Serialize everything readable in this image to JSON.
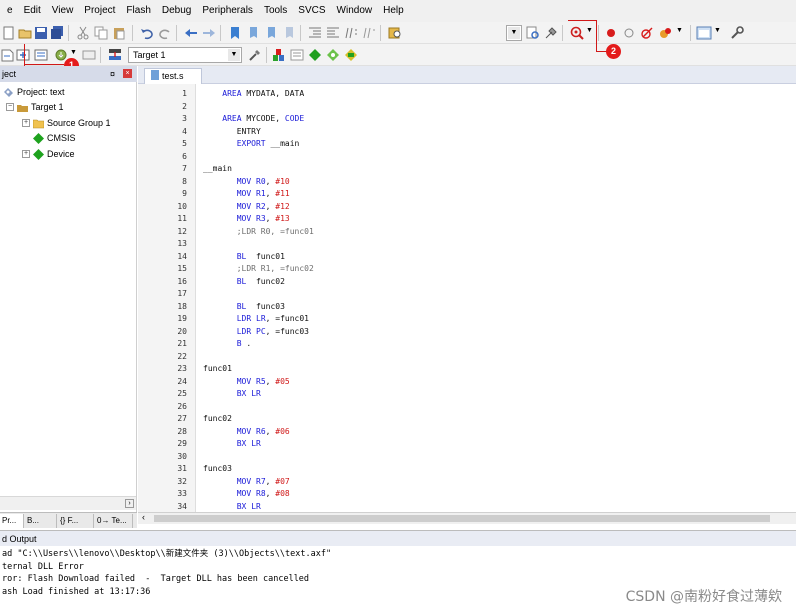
{
  "menu": [
    "e",
    "Edit",
    "View",
    "Project",
    "Flash",
    "Debug",
    "Peripherals",
    "Tools",
    "SVCS",
    "Window",
    "Help"
  ],
  "toolbar2": {
    "target_select": "Target 1"
  },
  "annotations": {
    "badge1": "1",
    "badge2": "2"
  },
  "project_pane": {
    "header": "ject",
    "root": "Project: text",
    "target": "Target 1",
    "items": [
      "Source Group 1",
      "CMSIS",
      "Device"
    ],
    "tabs": [
      "Pr...",
      "B...",
      "{} F...",
      "0→ Te..."
    ]
  },
  "editor": {
    "tab": "test.s",
    "lines": [
      {
        "n": "1",
        "t": [
          {
            "c": "    "
          },
          {
            "c": "AREA",
            "k": "kw"
          },
          {
            "c": " MYDATA, DATA"
          }
        ]
      },
      {
        "n": "2",
        "t": []
      },
      {
        "n": "3",
        "t": [
          {
            "c": "    "
          },
          {
            "c": "AREA",
            "k": "kw"
          },
          {
            "c": " MYCODE, "
          },
          {
            "c": "CODE",
            "k": "kw"
          }
        ]
      },
      {
        "n": "4",
        "t": [
          {
            "c": "       ENTRY"
          }
        ]
      },
      {
        "n": "5",
        "t": [
          {
            "c": "       "
          },
          {
            "c": "EXPORT",
            "k": "kw"
          },
          {
            "c": " __main"
          }
        ]
      },
      {
        "n": "6",
        "t": []
      },
      {
        "n": "7",
        "t": [
          {
            "c": "__main"
          }
        ]
      },
      {
        "n": "8",
        "t": [
          {
            "c": "       "
          },
          {
            "c": "MOV",
            "k": "kw"
          },
          {
            "c": " "
          },
          {
            "c": "R0",
            "k": "kw"
          },
          {
            "c": ", "
          },
          {
            "c": "#10",
            "k": "num"
          }
        ]
      },
      {
        "n": "9",
        "t": [
          {
            "c": "       "
          },
          {
            "c": "MOV",
            "k": "kw"
          },
          {
            "c": " "
          },
          {
            "c": "R1",
            "k": "kw"
          },
          {
            "c": ", "
          },
          {
            "c": "#11",
            "k": "num"
          }
        ]
      },
      {
        "n": "10",
        "t": [
          {
            "c": "       "
          },
          {
            "c": "MOV",
            "k": "kw"
          },
          {
            "c": " "
          },
          {
            "c": "R2",
            "k": "kw"
          },
          {
            "c": ", "
          },
          {
            "c": "#12",
            "k": "num"
          }
        ]
      },
      {
        "n": "11",
        "t": [
          {
            "c": "       "
          },
          {
            "c": "MOV",
            "k": "kw"
          },
          {
            "c": " "
          },
          {
            "c": "R3",
            "k": "kw"
          },
          {
            "c": ", "
          },
          {
            "c": "#13",
            "k": "num"
          }
        ]
      },
      {
        "n": "12",
        "t": [
          {
            "c": "       ;LDR R0, =func01",
            "k": "cm"
          }
        ]
      },
      {
        "n": "13",
        "t": []
      },
      {
        "n": "14",
        "t": [
          {
            "c": "       "
          },
          {
            "c": "BL",
            "k": "kw"
          },
          {
            "c": "  func01"
          }
        ]
      },
      {
        "n": "15",
        "t": [
          {
            "c": "       ;LDR R1, =func02",
            "k": "cm"
          }
        ]
      },
      {
        "n": "16",
        "t": [
          {
            "c": "       "
          },
          {
            "c": "BL",
            "k": "kw"
          },
          {
            "c": "  func02"
          }
        ]
      },
      {
        "n": "17",
        "t": []
      },
      {
        "n": "18",
        "t": [
          {
            "c": "       "
          },
          {
            "c": "BL",
            "k": "kw"
          },
          {
            "c": "  func03"
          }
        ]
      },
      {
        "n": "19",
        "t": [
          {
            "c": "       "
          },
          {
            "c": "LDR",
            "k": "kw"
          },
          {
            "c": " "
          },
          {
            "c": "LR",
            "k": "kw"
          },
          {
            "c": ", =func01"
          }
        ]
      },
      {
        "n": "20",
        "t": [
          {
            "c": "       "
          },
          {
            "c": "LDR",
            "k": "kw"
          },
          {
            "c": " "
          },
          {
            "c": "PC",
            "k": "kw"
          },
          {
            "c": ", =func03"
          }
        ]
      },
      {
        "n": "21",
        "t": [
          {
            "c": "       "
          },
          {
            "c": "B",
            "k": "kw"
          },
          {
            "c": " ."
          }
        ]
      },
      {
        "n": "22",
        "t": []
      },
      {
        "n": "23",
        "t": [
          {
            "c": "func01"
          }
        ]
      },
      {
        "n": "24",
        "t": [
          {
            "c": "       "
          },
          {
            "c": "MOV",
            "k": "kw"
          },
          {
            "c": " "
          },
          {
            "c": "R5",
            "k": "kw"
          },
          {
            "c": ", "
          },
          {
            "c": "#05",
            "k": "num"
          }
        ]
      },
      {
        "n": "25",
        "t": [
          {
            "c": "       "
          },
          {
            "c": "BX",
            "k": "kw"
          },
          {
            "c": " "
          },
          {
            "c": "LR",
            "k": "kw"
          }
        ]
      },
      {
        "n": "26",
        "t": []
      },
      {
        "n": "27",
        "t": [
          {
            "c": "func02"
          }
        ]
      },
      {
        "n": "28",
        "t": [
          {
            "c": "       "
          },
          {
            "c": "MOV",
            "k": "kw"
          },
          {
            "c": " "
          },
          {
            "c": "R6",
            "k": "kw"
          },
          {
            "c": ", "
          },
          {
            "c": "#06",
            "k": "num"
          }
        ]
      },
      {
        "n": "29",
        "t": [
          {
            "c": "       "
          },
          {
            "c": "BX",
            "k": "kw"
          },
          {
            "c": " "
          },
          {
            "c": "LR",
            "k": "kw"
          }
        ]
      },
      {
        "n": "30",
        "t": []
      },
      {
        "n": "31",
        "t": [
          {
            "c": "func03"
          }
        ]
      },
      {
        "n": "32",
        "t": [
          {
            "c": "       "
          },
          {
            "c": "MOV",
            "k": "kw"
          },
          {
            "c": " "
          },
          {
            "c": "R7",
            "k": "kw"
          },
          {
            "c": ", "
          },
          {
            "c": "#07",
            "k": "num"
          }
        ]
      },
      {
        "n": "33",
        "t": [
          {
            "c": "       "
          },
          {
            "c": "MOV",
            "k": "kw"
          },
          {
            "c": " "
          },
          {
            "c": "R8",
            "k": "kw"
          },
          {
            "c": ", "
          },
          {
            "c": "#08",
            "k": "num"
          }
        ]
      },
      {
        "n": "34",
        "t": [
          {
            "c": "       "
          },
          {
            "c": "BX",
            "k": "kw"
          },
          {
            "c": " "
          },
          {
            "c": "LR",
            "k": "kw"
          }
        ]
      }
    ]
  },
  "build_output": {
    "header": "d Output",
    "lines": [
      "ad \"C:\\\\Users\\\\lenovo\\\\Desktop\\\\新建文件夹 (3)\\\\Objects\\\\text.axf\"",
      "ternal DLL Error",
      "ror: Flash Download failed  -  Target DLL has been cancelled",
      "ash Load finished at 13:17:36"
    ]
  },
  "watermark": "CSDN @南粉好食过薄欸",
  "colors": {
    "accent_red": "#e41b1b",
    "keyword_blue": "#1a1ad8",
    "number_red": "#d01818"
  }
}
